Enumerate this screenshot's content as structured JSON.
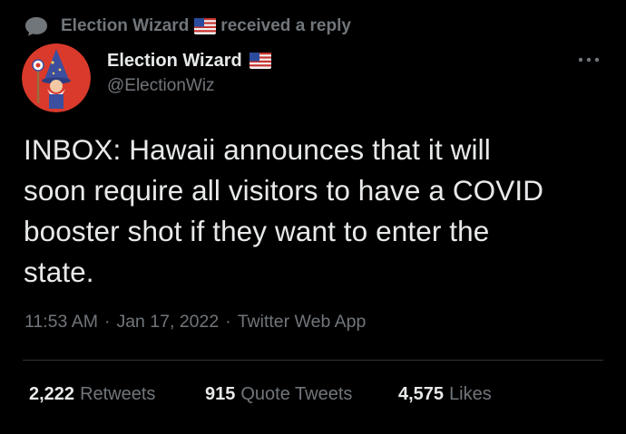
{
  "context": {
    "author_name": "Election Wizard",
    "action_text": "received a reply",
    "icon": "reply-bubble-icon"
  },
  "author": {
    "name": "Election Wizard",
    "handle": "@ElectionWiz",
    "badge_icon": "us-flag-icon",
    "avatar_icon": "wizard-avatar"
  },
  "more_icon": "more-dots-icon",
  "tweet": {
    "lines": [
      "INBOX: Hawaii announces that it will",
      "soon require all visitors to have a COVID",
      "booster shot if they want to enter the",
      "state."
    ]
  },
  "meta": {
    "time": "11:53 AM",
    "sep1": "·",
    "date": "Jan 17, 2022",
    "sep2": "·",
    "source": "Twitter Web App"
  },
  "stats": {
    "retweets": {
      "count": "2,222",
      "label": "Retweets"
    },
    "quotes": {
      "count": "915",
      "label": "Quote Tweets"
    },
    "likes": {
      "count": "4,575",
      "label": "Likes"
    }
  },
  "colors": {
    "background": "#000000",
    "text": "#e7e9ea",
    "muted": "#71767b",
    "avatar_bg": "#d93a2b"
  }
}
